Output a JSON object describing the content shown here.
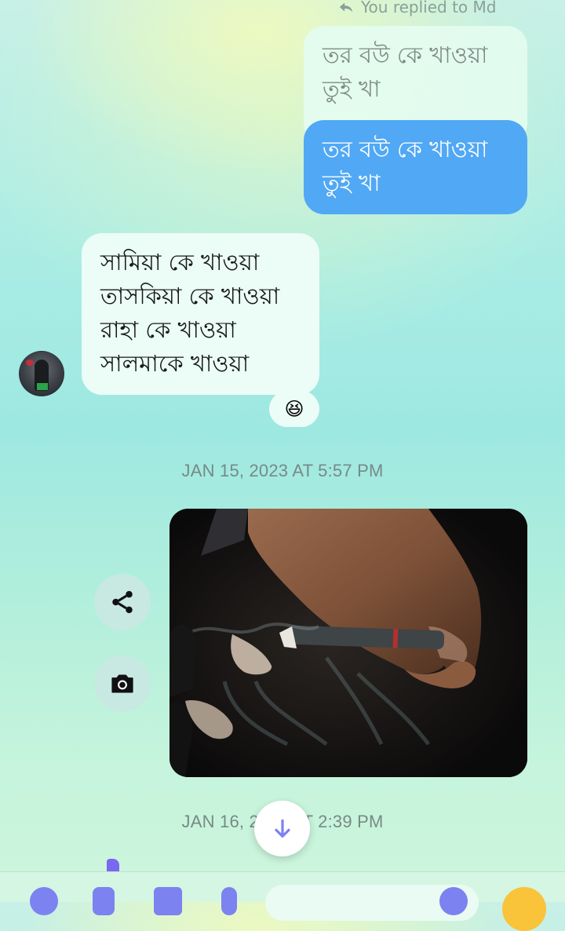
{
  "reply_note": {
    "text": "You replied to Md",
    "icon": "reply-arrow-icon"
  },
  "quoted_message": {
    "lines": [
      "তর বউ কে খাওয়া",
      "তুই খা"
    ]
  },
  "sent_message": {
    "lines": [
      "তর বউ কে খাওয়া",
      "তুই খা"
    ],
    "color": "#51a8f4"
  },
  "received_message": {
    "lines": [
      "সামিয়া কে খাওয়া",
      "তাসকিয়া কে খাওয়া",
      "রাহা কে খাওয়া",
      "সালমাকে খাওয়া"
    ],
    "reaction": "😆"
  },
  "timestamps": [
    "JAN 15, 2023 AT 5:57 PM",
    "JAN 16, 2023 AT 2:39 PM"
  ],
  "photo_actions": {
    "share": "share-icon",
    "camera": "camera-icon"
  },
  "scroll_button": {
    "icon": "arrow-down-icon"
  }
}
